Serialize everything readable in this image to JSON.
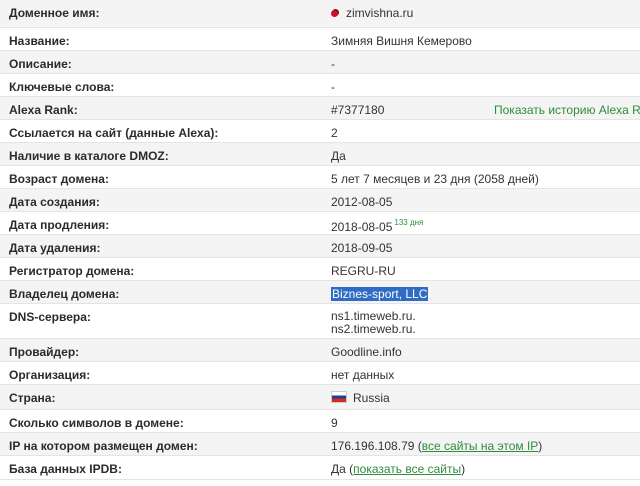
{
  "rows": [
    {
      "label": "Доменное имя:",
      "value": "zimvishna.ru",
      "icon": "cherry-favicon-icon"
    },
    {
      "label": "Название:",
      "value": "Зимняя Вишня Кемерово"
    },
    {
      "label": "Описание:",
      "value": "-"
    },
    {
      "label": "Ключевые слова:",
      "value": "-"
    },
    {
      "label": "Alexa Rank:",
      "value": "#7377180",
      "extra": "Показать историю Alexa Rank"
    },
    {
      "label": "Ссылается на сайт (данные Alexa):",
      "value": "2"
    },
    {
      "label": "Наличие в каталоге DMOZ:",
      "value": "Да"
    },
    {
      "label": "Возраст домена:",
      "value": "5 лет 7 месяцев и 23 дня (2058 дней)"
    },
    {
      "label": "Дата создания:",
      "value": "2012-08-05"
    },
    {
      "label": "Дата продления:",
      "value": "2018-08-05",
      "sup": "133 дня"
    },
    {
      "label": "Дата удаления:",
      "value": "2018-09-05"
    },
    {
      "label": "Регистратор домена:",
      "value": "REGRU-RU"
    },
    {
      "label": "Владелец домена:",
      "value": "Biznes-sport, LLC"
    },
    {
      "label": "DNS-сервера:",
      "value_lines": [
        "ns1.timeweb.ru.",
        "ns2.timeweb.ru."
      ]
    },
    {
      "label": "Провайдер:",
      "value": "Goodline.info"
    },
    {
      "label": "Организация:",
      "value": "нет данных"
    },
    {
      "label": "Страна:",
      "value": "Russia",
      "icon": "russia-flag-icon"
    },
    {
      "label": "Сколько символов в домене:",
      "value": "9"
    },
    {
      "label": "IP на котором размещен домен:",
      "value": "176.196.108.79",
      "paren_open": " (",
      "link": "все сайты на этом IP",
      "paren_close": ")"
    },
    {
      "label": "База данных IPDB:",
      "value": "Да",
      "paren_open": " (",
      "link": "показать все сайты",
      "paren_close": ")"
    }
  ],
  "colors": {
    "link": "#2f8c3b",
    "highlight": "#2f6cc4",
    "row_alt": "#f4f4f4"
  }
}
